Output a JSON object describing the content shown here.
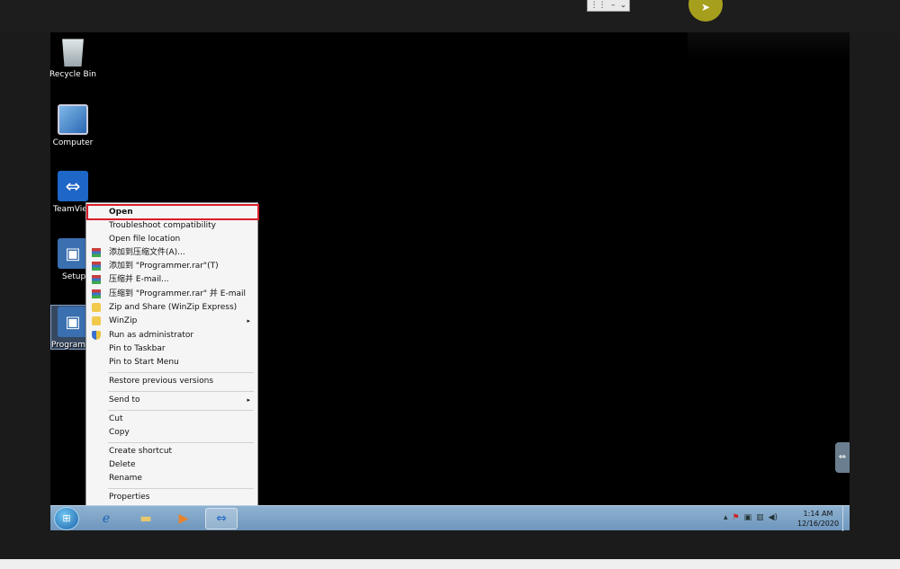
{
  "desktop": {
    "icons": [
      {
        "label": "Recycle Bin"
      },
      {
        "label": "Computer"
      },
      {
        "label": "TeamView"
      },
      {
        "label": "Setup"
      },
      {
        "label": "Programm"
      }
    ]
  },
  "context_menu": {
    "items": [
      {
        "label": "Open"
      },
      {
        "label": "Troubleshoot compatibility"
      },
      {
        "label": "Open file location"
      },
      {
        "label": "添加到压缩文件(A)..."
      },
      {
        "label": "添加到 \"Programmer.rar\"(T)"
      },
      {
        "label": "压缩并 E-mail..."
      },
      {
        "label": "压缩到 \"Programmer.rar\" 并 E-mail"
      },
      {
        "label": "Zip and Share (WinZip Express)"
      },
      {
        "label": "WinZip"
      },
      {
        "label": "Run as administrator"
      },
      {
        "label": "Pin to Taskbar"
      },
      {
        "label": "Pin to Start Menu"
      },
      {
        "label": "Restore previous versions"
      },
      {
        "label": "Send to"
      },
      {
        "label": "Cut"
      },
      {
        "label": "Copy"
      },
      {
        "label": "Create shortcut"
      },
      {
        "label": "Delete"
      },
      {
        "label": "Rename"
      },
      {
        "label": "Properties"
      }
    ],
    "submenu_glyph": "▸"
  },
  "taskbar": {
    "clock_time": "1:14 AM",
    "clock_date": "12/16/2020"
  },
  "colors": {
    "highlight_border": "#d81e2a",
    "taskbar": "#7fa4c8"
  }
}
